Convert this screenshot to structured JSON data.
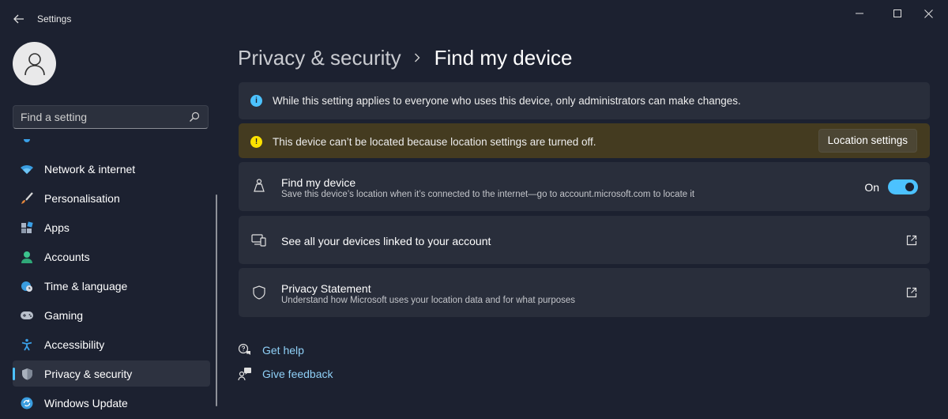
{
  "window": {
    "title": "Settings"
  },
  "search": {
    "placeholder": "Find a setting"
  },
  "sidebar": {
    "items": [
      {
        "label": "Network & internet",
        "icon": "wifi-icon",
        "selected": false
      },
      {
        "label": "Personalisation",
        "icon": "brush-icon",
        "selected": false
      },
      {
        "label": "Apps",
        "icon": "apps-icon",
        "selected": false
      },
      {
        "label": "Accounts",
        "icon": "person-icon",
        "selected": false
      },
      {
        "label": "Time & language",
        "icon": "globe-clock-icon",
        "selected": false
      },
      {
        "label": "Gaming",
        "icon": "gamepad-icon",
        "selected": false
      },
      {
        "label": "Accessibility",
        "icon": "accessibility-icon",
        "selected": false
      },
      {
        "label": "Privacy & security",
        "icon": "shield-icon",
        "selected": true
      },
      {
        "label": "Windows Update",
        "icon": "update-icon",
        "selected": false
      }
    ]
  },
  "breadcrumb": {
    "parent": "Privacy & security",
    "current": "Find my device"
  },
  "info_banner": {
    "text": "While this setting applies to everyone who uses this device, only administrators can make changes."
  },
  "warning_banner": {
    "text": "This device can’t be located because location settings are turned off.",
    "button": "Location settings"
  },
  "find_my_device": {
    "title": "Find my device",
    "subtitle": "Save this device’s location when it’s connected to the internet—go to account.microsoft.com to locate it",
    "toggle_label": "On"
  },
  "linked_devices": {
    "title": "See all your devices linked to your account"
  },
  "privacy_statement": {
    "title": "Privacy Statement",
    "subtitle": "Understand how Microsoft uses your location data and for what purposes"
  },
  "help": {
    "get_help": "Get help",
    "give_feedback": "Give feedback"
  },
  "colors": {
    "accent": "#4cc2ff",
    "warning_bg": "#443b20",
    "info_icon": "#4cc2ff",
    "warning_icon": "#fce100"
  }
}
